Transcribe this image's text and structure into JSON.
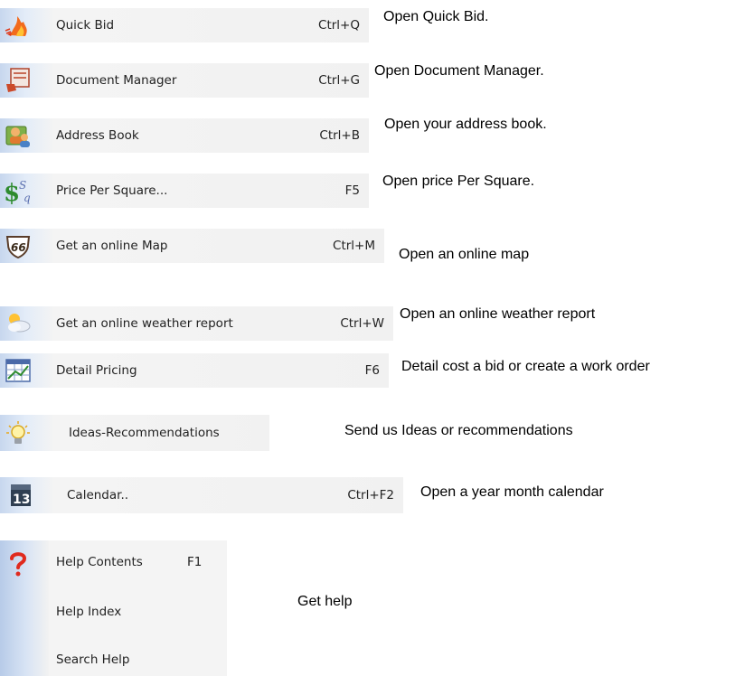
{
  "menu_items": [
    {
      "label": "Quick Bid",
      "shortcut": "Ctrl+Q",
      "description": "Open Quick Bid.",
      "icon": "flame-icon"
    },
    {
      "label": "Document Manager",
      "shortcut": "Ctrl+G",
      "description": "Open Document Manager.",
      "icon": "document-manager-icon"
    },
    {
      "label": "Address Book",
      "shortcut": "Ctrl+B",
      "description": "Open your address book.",
      "icon": "address-book-icon"
    },
    {
      "label": "Price Per Square...",
      "shortcut": "F5",
      "description": "Open price Per Square.",
      "icon": "price-per-square-icon"
    },
    {
      "label": "Get an online Map",
      "shortcut": "Ctrl+M",
      "description": "Open an online map",
      "icon": "route-66-map-icon"
    },
    {
      "label": "Get an online weather report",
      "shortcut": "Ctrl+W",
      "description": "Open an online weather report",
      "icon": "weather-cloud-icon"
    },
    {
      "label": "Detail Pricing",
      "shortcut": "F6",
      "description": "Detail cost a bid or create a work order",
      "icon": "chart-pricing-icon"
    },
    {
      "label": "Ideas-Recommendations",
      "shortcut": "",
      "description": "Send us Ideas or recommendations",
      "icon": "lightbulb-icon"
    },
    {
      "label": "Calendar..",
      "shortcut": "Ctrl+F2",
      "description": "Open a year month calendar",
      "icon": "calendar-icon"
    }
  ],
  "calendar_icon_day": "13",
  "help_menu": {
    "icon": "question-mark-icon",
    "items": [
      {
        "label": "Help Contents",
        "shortcut": "F1"
      },
      {
        "label": "Help Index",
        "shortcut": ""
      },
      {
        "label": "Search Help",
        "shortcut": ""
      }
    ],
    "description": "Get help"
  }
}
